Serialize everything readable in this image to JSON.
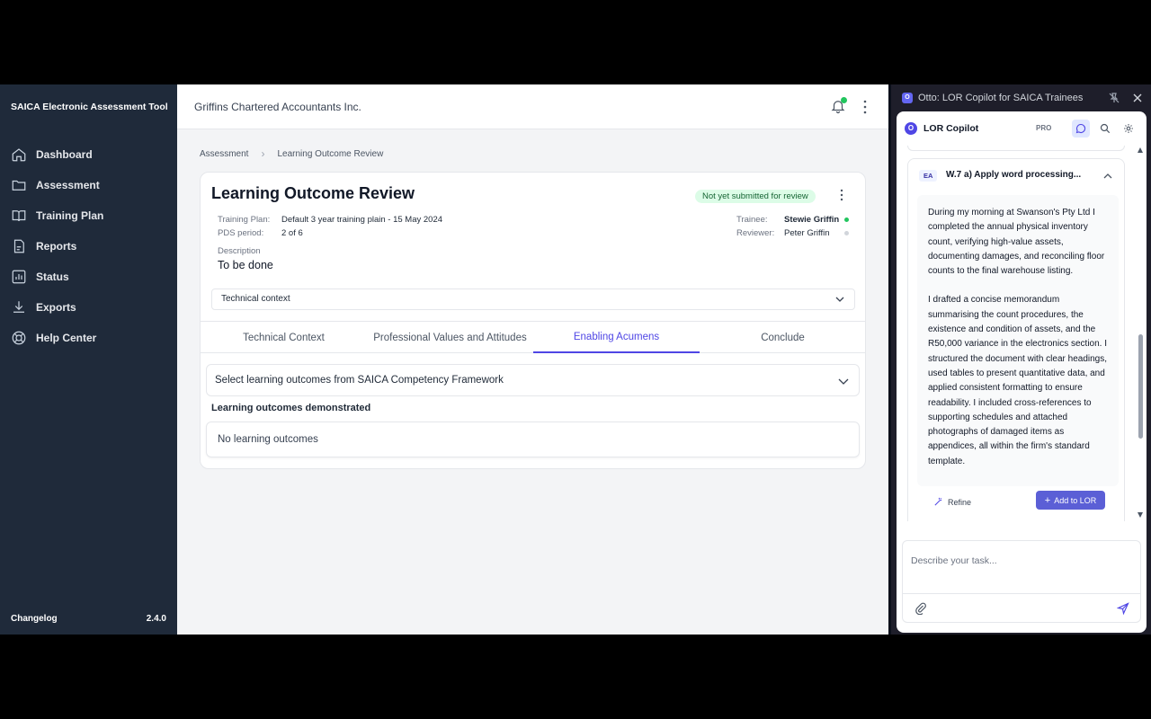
{
  "colors": {
    "accent": "#4f46e5",
    "sidebar": "#1f2a3a",
    "success": "#22c55e",
    "button": "#5b5fd6"
  },
  "sidebar": {
    "brand": "SAICA Electronic Assessment Tool",
    "items": [
      {
        "label": "Dashboard",
        "icon": "home-icon"
      },
      {
        "label": "Assessment",
        "icon": "folder-icon"
      },
      {
        "label": "Training Plan",
        "icon": "book-icon"
      },
      {
        "label": "Reports",
        "icon": "report-icon"
      },
      {
        "label": "Status",
        "icon": "chart-icon"
      },
      {
        "label": "Exports",
        "icon": "download-icon"
      },
      {
        "label": "Help Center",
        "icon": "lifebuoy-icon"
      }
    ],
    "changelog": "Changelog",
    "version": "2.4.0"
  },
  "header": {
    "company": "Griffins Chartered Accountants Inc."
  },
  "breadcrumb": [
    "Assessment",
    "Learning Outcome Review"
  ],
  "review": {
    "title": "Learning Outcome Review",
    "status": "Not yet submitted for review",
    "training_plan_label": "Training Plan:",
    "training_plan_value": "Default 3 year training plain - 15 May 2024",
    "pds_label": "PDS period:",
    "pds_value": "2 of 6",
    "trainee_label": "Trainee:",
    "trainee_value": "Stewie Griffin",
    "reviewer_label": "Reviewer:",
    "reviewer_value": "Peter Griffin",
    "description_label": "Description",
    "description_value": "To be done",
    "context_select": "Technical context"
  },
  "tabs": [
    "Technical Context",
    "Professional Values and Attitudes",
    "Enabling Acumens",
    "Conclude"
  ],
  "active_tab": 2,
  "outcomes": {
    "select_placeholder": "Select learning outcomes from SAICA Competency Framework",
    "heading": "Learning outcomes demonstrated",
    "empty": "No learning outcomes"
  },
  "panel": {
    "window_title": "Otto: LOR Copilot for SAICA Trainees",
    "logo": "O",
    "copilot_title": "LOR Copilot",
    "badge": "PRO",
    "entry": {
      "badge": "EA",
      "title": "W.7 a) Apply word processing...",
      "paragraph1": "During my morning at Swanson's Pty Ltd I completed the annual physical inventory count, verifying high-value assets, documenting damages, and reconciling floor counts to the final warehouse listing.",
      "paragraph2": "I drafted a concise memorandum summarising the count procedures, the existence and condition of assets, and the R50,000 variance in the electronics section. I structured the document with clear headings, used tables to present quantitative data, and applied consistent formatting to ensure readability. I included cross-references to supporting schedules and attached photographs of damaged items as appendices, all within the firm's standard template.",
      "refine": "Refine",
      "add": "Add to LOR"
    },
    "input_placeholder": "Describe your task..."
  }
}
